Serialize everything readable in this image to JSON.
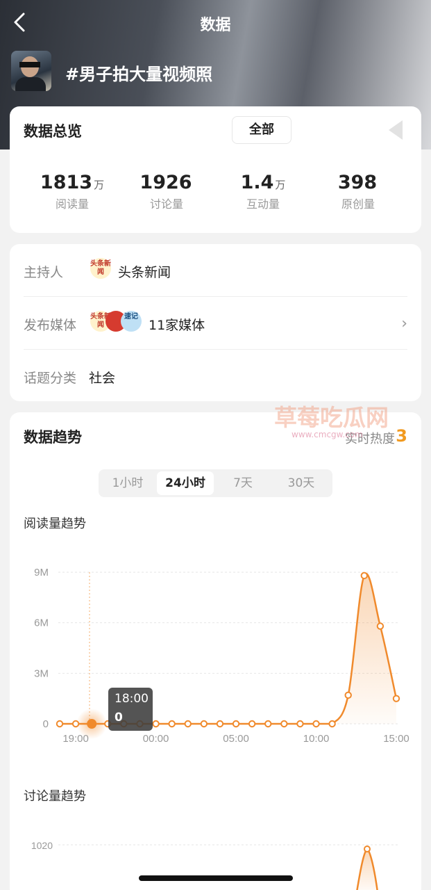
{
  "nav": {
    "title": "数据",
    "back_icon": "chevron-left-icon"
  },
  "topic": {
    "title": "#男子拍大量视频照"
  },
  "overview": {
    "title": "数据总览",
    "filter_label": "全部",
    "stats": [
      {
        "value": "1813",
        "unit": "万",
        "label": "阅读量"
      },
      {
        "value": "1926",
        "unit": "",
        "label": "讨论量"
      },
      {
        "value": "1.4",
        "unit": "万",
        "label": "互动量"
      },
      {
        "value": "398",
        "unit": "",
        "label": "原创量"
      }
    ]
  },
  "info": {
    "host_label": "主持人",
    "host_value": "头条新闻",
    "host_logo_text": "头条新闻",
    "media_label": "发布媒体",
    "media_value": "11家媒体",
    "media_logo_texts": [
      "头条新闻",
      "",
      "速记"
    ],
    "category_label": "话题分类",
    "category_value": "社会"
  },
  "trend": {
    "title": "数据趋势",
    "heat_label": "实时热度",
    "heat_value": "3",
    "tabs": [
      {
        "label": "1小时",
        "active": false
      },
      {
        "label": "24小时",
        "active": true
      },
      {
        "label": "7天",
        "active": false
      },
      {
        "label": "30天",
        "active": false
      }
    ],
    "read_title": "阅读量趋势",
    "discuss_title": "讨论量趋势"
  },
  "colors": {
    "accent": "#f08a2c",
    "heat": "#f19a20"
  },
  "chart_data": [
    {
      "type": "area",
      "title": "阅读量趋势",
      "y_ticks": [
        "0",
        "3M",
        "6M",
        "9M"
      ],
      "ylim": [
        0,
        9000000
      ],
      "x_ticks": [
        "19:00",
        "00:00",
        "05:00",
        "10:00",
        "15:00"
      ],
      "x": [
        "18:00",
        "19:00",
        "20:00",
        "21:00",
        "22:00",
        "23:00",
        "00:00",
        "01:00",
        "02:00",
        "03:00",
        "04:00",
        "05:00",
        "06:00",
        "07:00",
        "08:00",
        "09:00",
        "10:00",
        "11:00",
        "12:00",
        "13:00",
        "14:00",
        "15:00"
      ],
      "values": [
        0,
        0,
        0,
        0,
        0,
        0,
        0,
        0,
        0,
        0,
        0,
        0,
        0,
        0,
        0,
        0,
        0,
        0,
        1700000,
        8800000,
        5800000,
        1500000
      ],
      "tooltip": {
        "time": "18:00",
        "value": "0"
      }
    },
    {
      "type": "area",
      "title": "讨论量趋势",
      "y_ticks": [
        "1020"
      ]
    }
  ]
}
